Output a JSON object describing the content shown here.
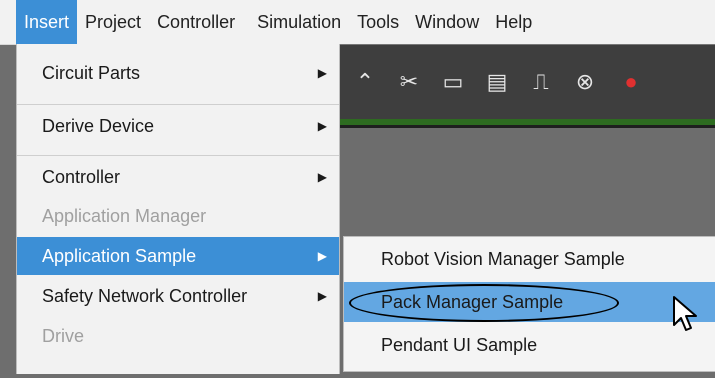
{
  "menubar": {
    "items": [
      "Insert",
      "Project",
      "Controller",
      "Simulation",
      "Tools",
      "Window",
      "Help"
    ]
  },
  "menu": {
    "items": [
      {
        "label": "Circuit Parts",
        "submenu": true,
        "enabled": true
      },
      {
        "label": "Derive Device",
        "submenu": true,
        "enabled": true
      },
      {
        "label": "Controller",
        "submenu": true,
        "enabled": true
      },
      {
        "label": "Application Manager",
        "submenu": false,
        "enabled": false
      },
      {
        "label": "Application Sample",
        "submenu": true,
        "enabled": true,
        "highlighted": true
      },
      {
        "label": "Safety Network Controller",
        "submenu": true,
        "enabled": true
      },
      {
        "label": "Drive",
        "submenu": false,
        "enabled": false
      }
    ]
  },
  "submenu": {
    "items": [
      {
        "label": "Robot Vision Manager Sample"
      },
      {
        "label": "Pack Manager Sample",
        "highlighted": true
      },
      {
        "label": "Pendant UI Sample"
      }
    ]
  },
  "colors": {
    "highlight": "#3c8fd6",
    "submenu_highlight": "#63a7e2",
    "toolbar_bg": "#3e3e3e",
    "toolbar_accent": "#2d6b20"
  },
  "icons": [
    "hammer-icon",
    "wire-cut-icon",
    "io-block-icon",
    "io-block-2-icon",
    "signal-icon",
    "binoculars-icon",
    "record-icon"
  ]
}
